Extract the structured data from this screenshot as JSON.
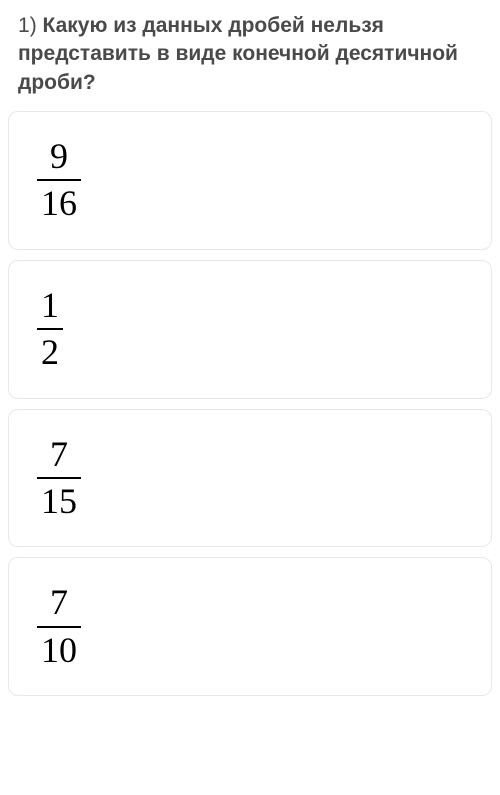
{
  "question": {
    "number": "1",
    "separator": ") ",
    "text": "Какую из данных дробей нельзя представить в виде конечной десятичной дроби?"
  },
  "options": [
    {
      "numerator": "9",
      "denominator": "16"
    },
    {
      "numerator": "1",
      "denominator": "2"
    },
    {
      "numerator": "7",
      "denominator": "15"
    },
    {
      "numerator": "7",
      "denominator": "10"
    }
  ]
}
